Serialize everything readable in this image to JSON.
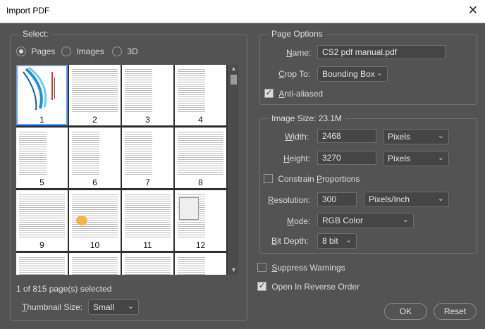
{
  "window": {
    "title": "Import PDF",
    "close_glyph": "✕"
  },
  "select": {
    "legend": "Select:",
    "options": [
      "Pages",
      "Images",
      "3D"
    ],
    "selected": "Pages",
    "thumbnails": [
      "1",
      "2",
      "3",
      "4",
      "5",
      "6",
      "7",
      "8",
      "9",
      "10",
      "11",
      "12"
    ],
    "status": "1 of 815 page(s) selected",
    "thumb_size_label": "Thumbnail Size:",
    "thumb_size_value": "Small"
  },
  "page_options": {
    "legend": "Page Options",
    "name_label": "Name:",
    "name_value": "CS2 pdf manual.pdf",
    "crop_label": "Crop To:",
    "crop_value": "Bounding Box",
    "antialiased_label": "Anti-aliased",
    "antialiased_checked": true
  },
  "image_size": {
    "legend": "Image Size: 23.1M",
    "width_label": "Width:",
    "width_value": "2468",
    "width_unit": "Pixels",
    "height_label": "Height:",
    "height_value": "3270",
    "height_unit": "Pixels",
    "constrain_label": "Constrain Proportions",
    "constrain_checked": false,
    "resolution_label": "Resolution:",
    "resolution_value": "300",
    "resolution_unit": "Pixels/Inch",
    "mode_label": "Mode:",
    "mode_value": "RGB Color",
    "bitdepth_label": "Bit Depth:",
    "bitdepth_value": "8 bit"
  },
  "options": {
    "suppress_label": "Suppress Warnings",
    "suppress_checked": false,
    "reverse_label": "Open In Reverse Order",
    "reverse_checked": true
  },
  "buttons": {
    "ok": "OK",
    "reset": "Reset"
  }
}
